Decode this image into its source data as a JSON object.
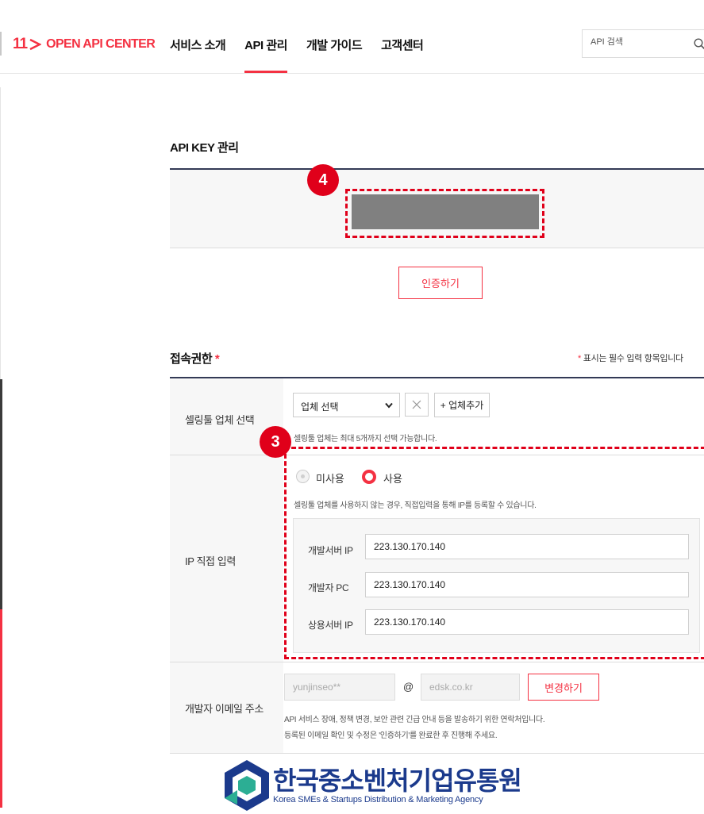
{
  "header": {
    "logo_num": "11",
    "logo_text": "OPEN API CENTER",
    "nav": [
      "서비스 소개",
      "API 관리",
      "개발 가이드",
      "고객센터"
    ],
    "active_nav": "API 관리",
    "search_placeholder": "API 검색"
  },
  "api_key": {
    "title": "API KEY 관리",
    "auth_button": "인증하기"
  },
  "annotations": {
    "badge_4": "4",
    "badge_3": "3"
  },
  "access": {
    "title": "접속권한",
    "title_star": "*",
    "required_star": "*",
    "required_note": "표시는 필수 입력 항목입니다",
    "vendor": {
      "label": "셀링툴 업체 선택",
      "select_value": "업체 선택",
      "add_button": "+ 업체추가",
      "help": "셀링툴 업체는 최대 5개까지 선택 가능합니다."
    },
    "ip": {
      "label": "IP 직접 입력",
      "option_off": "미사용",
      "option_on": "사용",
      "selected": "사용",
      "help": "셀링툴 업체를 사용하지 않는 경우, 직접입력을 통해 IP를 등록할 수 있습니다.",
      "rows": [
        {
          "label": "개발서버 IP",
          "value": "223.130.170.140"
        },
        {
          "label": "개발자 PC",
          "value": "223.130.170.140"
        },
        {
          "label": "상용서버 IP",
          "value": "223.130.170.140"
        }
      ]
    },
    "email": {
      "label": "개발자 이메일 주소",
      "local_part": "yunjinseo**",
      "at": "@",
      "domain": "edsk.co.kr",
      "change_button": "변경하기",
      "help_1": "API 서비스 장애, 정책 변경, 보안 관련 긴급 안내 등을 발송하기 위한 연락처입니다.",
      "help_2": "등록된 이메일 확인 및 수정은 '인증하기'를 완료한 후 진행해 주세요."
    }
  },
  "footer": {
    "org_name": "한국중소벤처기업유통원",
    "org_name_en": "Korea SMEs & Startups Distribution & Marketing Agency"
  },
  "colors": {
    "brand_red": "#f43142",
    "annotation_red": "#e0001a",
    "navy": "#333a56",
    "footer_blue": "#1b3a8c"
  }
}
